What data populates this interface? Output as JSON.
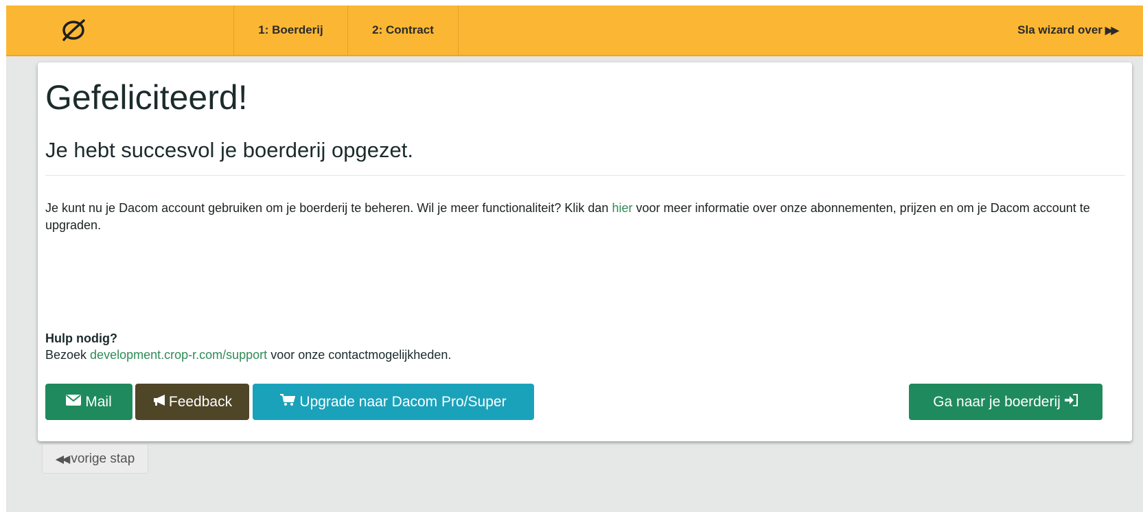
{
  "nav": {
    "logo_icon": "leaf-icon",
    "step1": "1: Boerderij",
    "step2": "2: Contract",
    "skip_label": "Sla wizard over",
    "skip_icon": "fast-forward-icon"
  },
  "card": {
    "title": "Gefeliciteerd!",
    "subtitle": "Je hebt succesvol je boerderij opgezet.",
    "info_before": "Je kunt nu je Dacom account gebruiken om je boerderij te beheren. Wil je meer functionaliteit? Klik dan ",
    "info_link": "hier",
    "info_after": " voor meer informatie over onze abonnementen, prijzen en om je Dacom account te upgraden.",
    "help_title": "Hulp nodig?",
    "help_before": "Bezoek ",
    "help_link": "development.crop-r.com/support",
    "help_after": " voor onze contactmogelijkheden."
  },
  "buttons": {
    "mail": "Mail",
    "feedback": "Feedback",
    "upgrade": "Upgrade naar Dacom Pro/Super",
    "go": "Ga naar je boerderij",
    "prev": "vorige stap"
  },
  "colors": {
    "topbar": "#fbb733",
    "green": "#1f8a5d",
    "brown": "#4f4527",
    "teal": "#1ba2bb",
    "link": "#2e8b57"
  }
}
